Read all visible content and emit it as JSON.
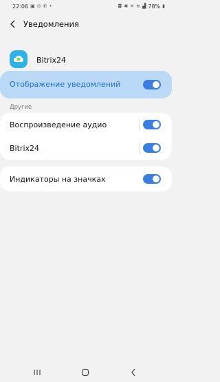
{
  "status_bar": {
    "time": "22:06",
    "battery": "78%"
  },
  "header": {
    "title": "Уведомления"
  },
  "app": {
    "name": "Bitrix24"
  },
  "main_toggle": {
    "label": "Отображение уведомлений",
    "on": true
  },
  "section": {
    "header": "Другие"
  },
  "rows": [
    {
      "label": "Воспроизведение аудио",
      "on": true
    },
    {
      "label": "Bitrix24",
      "on": true
    }
  ],
  "badge_row": {
    "label": "Индикаторы на значках",
    "on": true
  },
  "colors": {
    "accent": "#3a7fe0",
    "highlight_bg": "#b9d9f6",
    "highlight_text": "#1e6fc4",
    "app_icon": "#2fb3e6"
  },
  "icons": {
    "back": "back-arrow-icon",
    "app": "bitrix24-app-icon",
    "nav": [
      "recent-apps-icon",
      "home-icon",
      "back-nav-icon"
    ]
  }
}
